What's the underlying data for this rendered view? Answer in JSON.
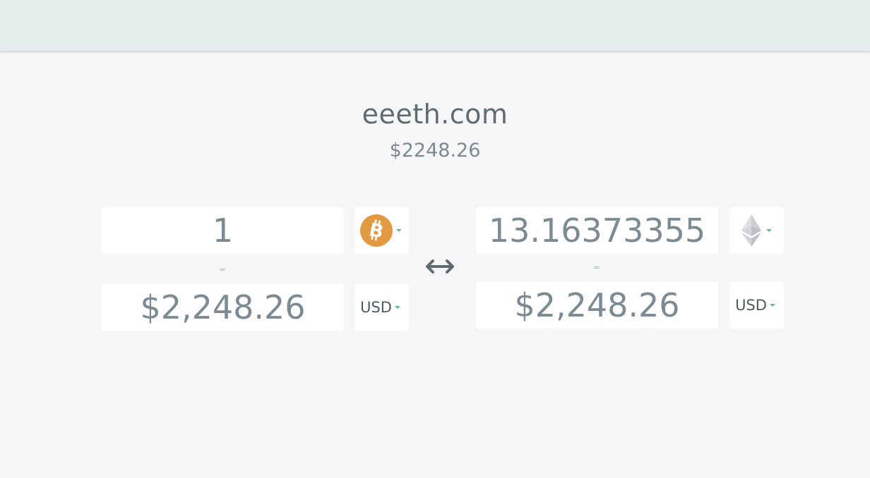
{
  "header": {},
  "site": {
    "title": "eeeth.com",
    "price": "$2248.26"
  },
  "left": {
    "crypto_amount": "1",
    "crypto_icon": "bitcoin-icon",
    "crypto_color": "#e29a42",
    "equals": "=",
    "fiat_amount": "$2,248.26",
    "fiat_currency": "USD"
  },
  "right": {
    "crypto_amount": "13.16373355",
    "crypto_icon": "ethereum-icon",
    "equals": "=",
    "fiat_amount": "$2,248.26",
    "fiat_currency": "USD"
  },
  "swap_icon": "double-arrow-icon",
  "colors": {
    "background": "#f6f6f6",
    "topbar": "#e6eeed",
    "text": "#7b8a93",
    "accent": "#5fb5ad"
  }
}
